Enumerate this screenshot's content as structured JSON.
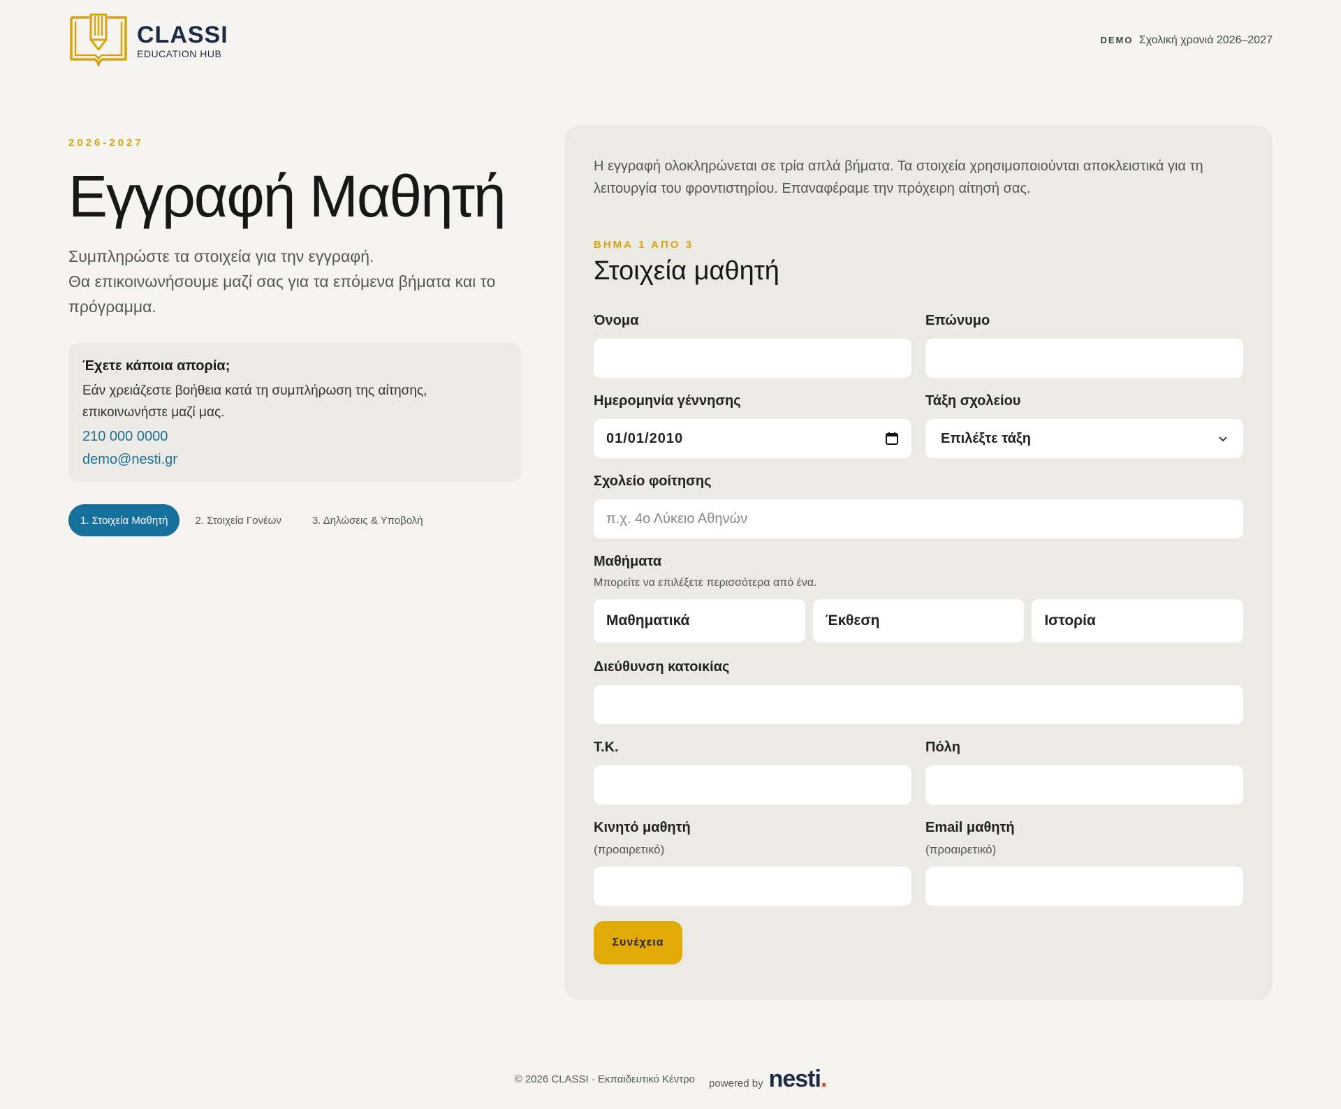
{
  "header": {
    "logo_name": "CLASSI",
    "logo_sub": "EDUCATION HUB",
    "demo_label": "DEMO",
    "school_year": "Σχολική χρονιά 2026–2027"
  },
  "left": {
    "eyebrow": "2026-2027",
    "title": "Εγγραφή Μαθητή",
    "lead_line1": "Συμπληρώστε τα στοιχεία για την εγγραφή.",
    "lead_line2": "Θα επικοινωνήσουμε μαζί σας για τα επόμενα βήματα και το πρόγραμμα.",
    "help": {
      "title": "Έχετε κάποια απορία;",
      "text": "Εάν χρειάζεστε βοήθεια κατά τη συμπλήρωση της αίτησης, επικοινωνήστε μαζί μας.",
      "phone": "210 000 0000",
      "email": "demo@nesti.gr"
    },
    "steps": [
      {
        "label": "1. Στοιχεία Μαθητή"
      },
      {
        "label": "2. Στοιχεία Γονέων"
      },
      {
        "label": "3. Δηλώσεις & Υποβολή"
      }
    ]
  },
  "form": {
    "intro": "Η εγγραφή ολοκληρώνεται σε τρία απλά βήματα. Τα στοιχεία χρησιμοποιούνται αποκλειστικά για τη λειτουργία του φροντιστηρίου. Επαναφέραμε την πρόχειρη αίτησή σας.",
    "step_eyebrow": "ΒΗΜΑ 1 ΑΠΟ 3",
    "section_title": "Στοιχεία μαθητή",
    "first_name_label": "Όνομα",
    "last_name_label": "Επώνυμο",
    "birth_label": "Ημερομηνία γέννησης",
    "birth_value": "01/01/2010",
    "class_label": "Τάξη σχολείου",
    "class_value": "Επιλέξτε τάξη",
    "school_label": "Σχολείο φοίτησης",
    "school_placeholder": "π.χ. 4ο Λύκειο Αθηνών",
    "subjects_label": "Μαθήματα",
    "subjects_hint": "Μπορείτε να επιλέξετε περισσότερα από ένα.",
    "subjects": [
      "Μαθηματικά",
      "Έκθεση",
      "Ιστορία"
    ],
    "address_label": "Διεύθυνση κατοικίας",
    "zip_label": "Τ.Κ.",
    "city_label": "Πόλη",
    "mobile_label": "Κινητό μαθητή",
    "email_label": "Email μαθητή",
    "optional": "(προαιρετικό)",
    "continue_label": "Συνέχεια"
  },
  "footer": {
    "copyright": "© 2026 CLASSI · Εκπαιδευτικό Κέντρο",
    "powered_by": "powered by",
    "brand": "nesti",
    "brand_dot": "."
  },
  "colors": {
    "accent": "#e1aa06",
    "primary": "#176f9c",
    "background": "#f5f4f0",
    "card": "#ebeae5"
  }
}
